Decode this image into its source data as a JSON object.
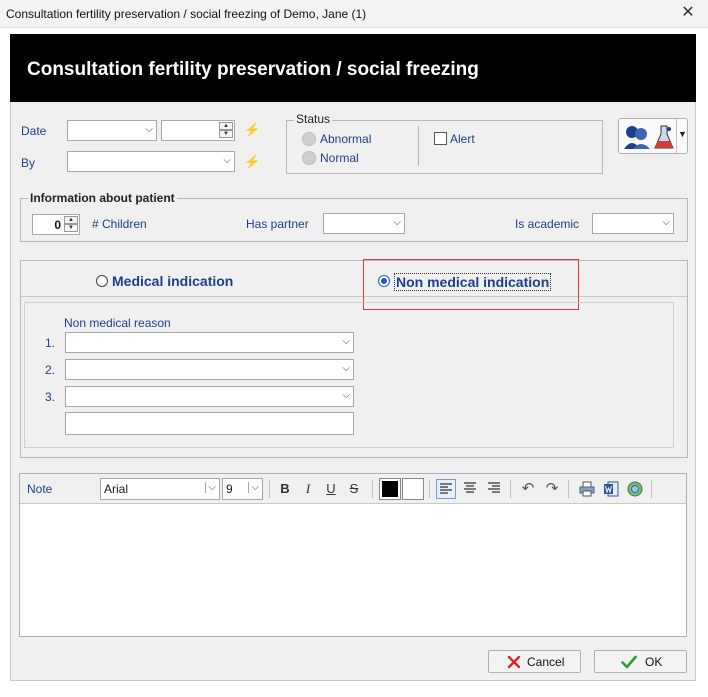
{
  "window": {
    "title": "Consultation fertility preservation / social freezing of Demo, Jane (1)",
    "close_glyph": "✕"
  },
  "header": {
    "title": "Consultation fertility preservation / social freezing"
  },
  "form": {
    "date_label": "Date",
    "by_label": "By",
    "date_value": "",
    "time_value": "",
    "by_value": ""
  },
  "status": {
    "legend": "Status",
    "abnormal_label": "Abnormal",
    "normal_label": "Normal",
    "alert_label": "Alert"
  },
  "patient_info": {
    "legend": "Information about patient",
    "children_value": "0",
    "children_label": "# Children",
    "has_partner_label": "Has partner",
    "has_partner_value": "",
    "is_academic_label": "Is academic",
    "is_academic_value": ""
  },
  "indication": {
    "medical_label": "Medical indication",
    "non_medical_label": "Non medical indication",
    "selected": "non_medical"
  },
  "non_medical": {
    "reason_label": "Non medical reason",
    "rows": [
      {
        "num": "1.",
        "value": ""
      },
      {
        "num": "2.",
        "value": ""
      },
      {
        "num": "3.",
        "value": ""
      }
    ],
    "free_text": ""
  },
  "note": {
    "label": "Note",
    "font_value": "Arial",
    "size_value": "9",
    "bold": "B",
    "italic": "I",
    "underline": "U",
    "strike": "S",
    "text": ""
  },
  "buttons": {
    "cancel": "Cancel",
    "ok": "OK"
  },
  "colors": {
    "accent": "#1f5fb8",
    "label_blue": "#1d3f8a",
    "highlight_red": "#d63b3b"
  }
}
